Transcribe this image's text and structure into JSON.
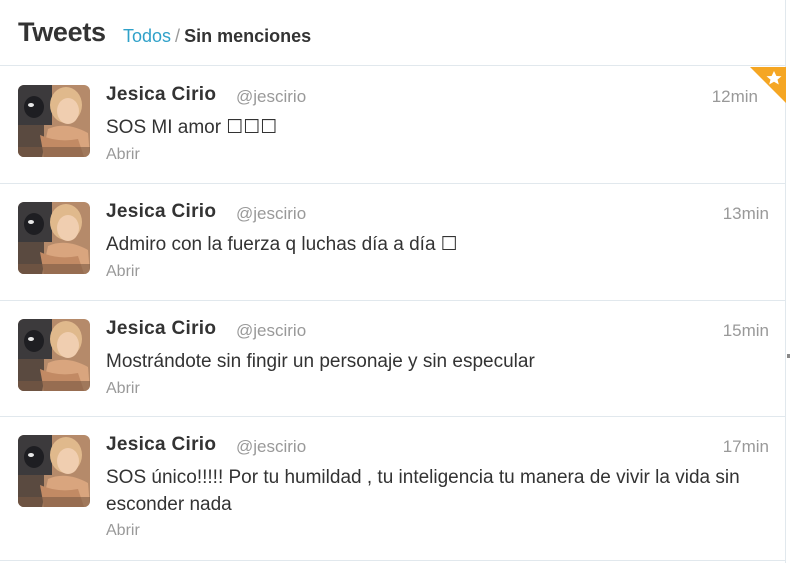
{
  "header": {
    "title": "Tweets",
    "filter_all": "Todos",
    "filter_separator": "/",
    "filter_active": "Sin menciones"
  },
  "colors": {
    "link": "#2fa1c9",
    "muted": "#999999",
    "favorite_corner": "#f5a623"
  },
  "tweets": [
    {
      "name": "Jesica Cirio",
      "handle": "@jescirio",
      "time": "12min",
      "text": "SOS MI amor ☐☐☐",
      "open_label": "Abrir",
      "favorited": true
    },
    {
      "name": "Jesica Cirio",
      "handle": "@jescirio",
      "time": "13min",
      "text": "Admiro con la fuerza q luchas día a día ☐",
      "open_label": "Abrir",
      "favorited": false
    },
    {
      "name": "Jesica Cirio",
      "handle": "@jescirio",
      "time": "15min",
      "text": "Mostrándote sin fingir un personaje y sin especular",
      "open_label": "Abrir",
      "favorited": false
    },
    {
      "name": "Jesica Cirio",
      "handle": "@jescirio",
      "time": "17min",
      "text": "SOS único!!!!! Por tu humildad , tu inteligencia tu manera de vivir la vida sin esconder nada",
      "open_label": "Abrir",
      "favorited": false
    }
  ]
}
